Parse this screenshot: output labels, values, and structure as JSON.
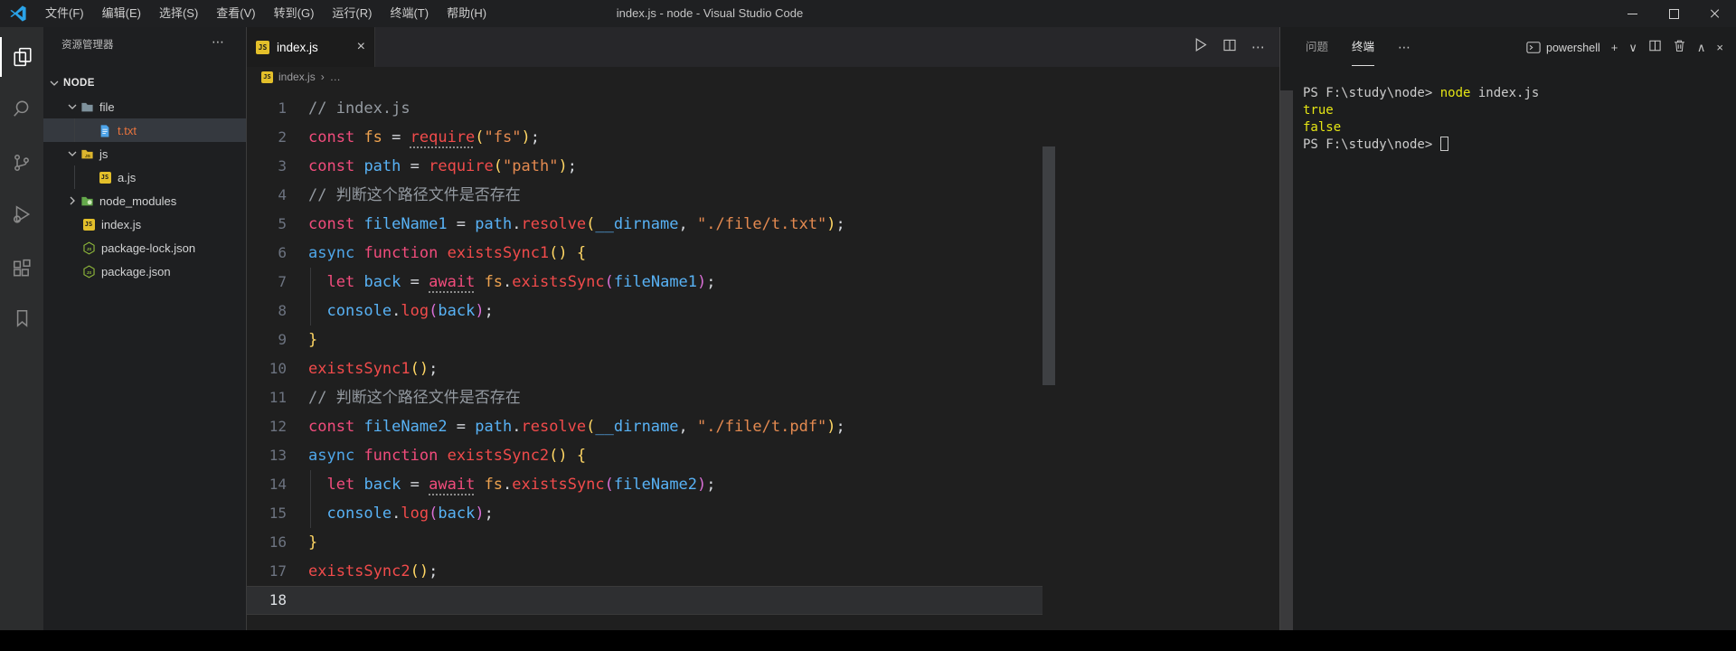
{
  "window": {
    "title": "index.js - node - Visual Studio Code",
    "menus": [
      "文件(F)",
      "编辑(E)",
      "选择(S)",
      "查看(V)",
      "转到(G)",
      "运行(R)",
      "终端(T)",
      "帮助(H)"
    ]
  },
  "icons": {
    "more": "⋯",
    "plus": "+",
    "chevron_down": "∨",
    "chevron_up": "∧",
    "close": "×",
    "breadcrumb_sep": "›",
    "breadcrumb_more": "…",
    "js_badge": "JS"
  },
  "colors": {
    "js_yellow": "#e3bf2a",
    "node_green": "#8fb83a",
    "terminal_yellow": "#e5e514",
    "modified_file_orange": "#e8743e",
    "keyword_pink": "#f14c7c",
    "function_red": "#f14b4b",
    "string_orange": "#e48a50",
    "variable_blue": "#58b2f5",
    "bracket_gold": "#ffd664",
    "bracket_orchid": "#d96fd6"
  },
  "sidebar": {
    "title": "资源管理器",
    "section": "NODE",
    "items": [
      {
        "label": "file",
        "icon": "folder",
        "chevron": "down",
        "level": 1
      },
      {
        "label": "t.txt",
        "icon": "txt",
        "level": 2,
        "selected": true
      },
      {
        "label": "js",
        "icon": "folder-js",
        "chevron": "down",
        "level": 1
      },
      {
        "label": "a.js",
        "icon": "js",
        "level": 2
      },
      {
        "label": "node_modules",
        "icon": "folder-node",
        "chevron": "right",
        "level": 1
      },
      {
        "label": "index.js",
        "icon": "js",
        "level": 1
      },
      {
        "label": "package-lock.json",
        "icon": "node",
        "level": 1
      },
      {
        "label": "package.json",
        "icon": "node",
        "level": 1
      }
    ]
  },
  "editor": {
    "tab": {
      "label": "index.js"
    },
    "breadcrumb": {
      "file": "index.js"
    },
    "lines": [
      {
        "n": 1,
        "tokens": [
          {
            "t": "// index.js",
            "c": "cmt"
          }
        ]
      },
      {
        "n": 2,
        "tokens": [
          {
            "t": "const",
            "c": "kw"
          },
          {
            "t": " ",
            "c": "op"
          },
          {
            "t": "fs",
            "c": "fsv"
          },
          {
            "t": " = ",
            "c": "op"
          },
          {
            "t": "require",
            "c": "fn",
            "hint": true
          },
          {
            "t": "(",
            "c": "p1"
          },
          {
            "t": "\"fs\"",
            "c": "str"
          },
          {
            "t": ")",
            "c": "p1"
          },
          {
            "t": ";",
            "c": "op"
          }
        ]
      },
      {
        "n": 3,
        "tokens": [
          {
            "t": "const",
            "c": "kw"
          },
          {
            "t": " ",
            "c": "op"
          },
          {
            "t": "path",
            "c": "var"
          },
          {
            "t": " = ",
            "c": "op"
          },
          {
            "t": "require",
            "c": "fn"
          },
          {
            "t": "(",
            "c": "p1"
          },
          {
            "t": "\"path\"",
            "c": "str"
          },
          {
            "t": ")",
            "c": "p1"
          },
          {
            "t": ";",
            "c": "op"
          }
        ]
      },
      {
        "n": 4,
        "tokens": [
          {
            "t": "// 判断这个路径文件是否存在",
            "c": "cmt"
          }
        ]
      },
      {
        "n": 5,
        "tokens": [
          {
            "t": "const",
            "c": "kw"
          },
          {
            "t": " ",
            "c": "op"
          },
          {
            "t": "fileName1",
            "c": "var"
          },
          {
            "t": " = ",
            "c": "op"
          },
          {
            "t": "path",
            "c": "var"
          },
          {
            "t": ".",
            "c": "op"
          },
          {
            "t": "resolve",
            "c": "fn"
          },
          {
            "t": "(",
            "c": "p1"
          },
          {
            "t": "__dirname",
            "c": "var"
          },
          {
            "t": ", ",
            "c": "op"
          },
          {
            "t": "\"./file/t.txt\"",
            "c": "str"
          },
          {
            "t": ")",
            "c": "p1"
          },
          {
            "t": ";",
            "c": "op"
          }
        ]
      },
      {
        "n": 6,
        "tokens": [
          {
            "t": "async",
            "c": "async"
          },
          {
            "t": " ",
            "c": "op"
          },
          {
            "t": "function",
            "c": "kw"
          },
          {
            "t": " ",
            "c": "op"
          },
          {
            "t": "existsSync1",
            "c": "fn"
          },
          {
            "t": "()",
            "c": "p1"
          },
          {
            "t": " ",
            "c": "op"
          },
          {
            "t": "{",
            "c": "p1"
          }
        ]
      },
      {
        "n": 7,
        "guide": true,
        "tokens": [
          {
            "t": "  ",
            "c": "op"
          },
          {
            "t": "let",
            "c": "kw"
          },
          {
            "t": " ",
            "c": "op"
          },
          {
            "t": "back",
            "c": "var"
          },
          {
            "t": " = ",
            "c": "op"
          },
          {
            "t": "await",
            "c": "kw",
            "hint": true
          },
          {
            "t": " ",
            "c": "op"
          },
          {
            "t": "fs",
            "c": "fsv"
          },
          {
            "t": ".",
            "c": "op"
          },
          {
            "t": "existsSync",
            "c": "fn"
          },
          {
            "t": "(",
            "c": "p2"
          },
          {
            "t": "fileName1",
            "c": "var"
          },
          {
            "t": ")",
            "c": "p2"
          },
          {
            "t": ";",
            "c": "op"
          }
        ]
      },
      {
        "n": 8,
        "guide": true,
        "tokens": [
          {
            "t": "  ",
            "c": "op"
          },
          {
            "t": "console",
            "c": "var"
          },
          {
            "t": ".",
            "c": "op"
          },
          {
            "t": "log",
            "c": "fn"
          },
          {
            "t": "(",
            "c": "p2"
          },
          {
            "t": "back",
            "c": "var"
          },
          {
            "t": ")",
            "c": "p2"
          },
          {
            "t": ";",
            "c": "op"
          }
        ]
      },
      {
        "n": 9,
        "tokens": [
          {
            "t": "}",
            "c": "p1"
          }
        ]
      },
      {
        "n": 10,
        "tokens": [
          {
            "t": "existsSync1",
            "c": "fn"
          },
          {
            "t": "()",
            "c": "p1"
          },
          {
            "t": ";",
            "c": "op"
          }
        ]
      },
      {
        "n": 11,
        "tokens": [
          {
            "t": "// 判断这个路径文件是否存在",
            "c": "cmt"
          }
        ]
      },
      {
        "n": 12,
        "tokens": [
          {
            "t": "const",
            "c": "kw"
          },
          {
            "t": " ",
            "c": "op"
          },
          {
            "t": "fileName2",
            "c": "var"
          },
          {
            "t": " = ",
            "c": "op"
          },
          {
            "t": "path",
            "c": "var"
          },
          {
            "t": ".",
            "c": "op"
          },
          {
            "t": "resolve",
            "c": "fn"
          },
          {
            "t": "(",
            "c": "p1"
          },
          {
            "t": "__dirname",
            "c": "var"
          },
          {
            "t": ", ",
            "c": "op"
          },
          {
            "t": "\"./file/t.pdf\"",
            "c": "str"
          },
          {
            "t": ")",
            "c": "p1"
          },
          {
            "t": ";",
            "c": "op"
          }
        ]
      },
      {
        "n": 13,
        "tokens": [
          {
            "t": "async",
            "c": "async"
          },
          {
            "t": " ",
            "c": "op"
          },
          {
            "t": "function",
            "c": "kw"
          },
          {
            "t": " ",
            "c": "op"
          },
          {
            "t": "existsSync2",
            "c": "fn"
          },
          {
            "t": "()",
            "c": "p1"
          },
          {
            "t": " ",
            "c": "op"
          },
          {
            "t": "{",
            "c": "p1"
          }
        ]
      },
      {
        "n": 14,
        "guide": true,
        "tokens": [
          {
            "t": "  ",
            "c": "op"
          },
          {
            "t": "let",
            "c": "kw"
          },
          {
            "t": " ",
            "c": "op"
          },
          {
            "t": "back",
            "c": "var"
          },
          {
            "t": " = ",
            "c": "op"
          },
          {
            "t": "await",
            "c": "kw",
            "hint": true
          },
          {
            "t": " ",
            "c": "op"
          },
          {
            "t": "fs",
            "c": "fsv"
          },
          {
            "t": ".",
            "c": "op"
          },
          {
            "t": "existsSync",
            "c": "fn"
          },
          {
            "t": "(",
            "c": "p2"
          },
          {
            "t": "fileName2",
            "c": "var"
          },
          {
            "t": ")",
            "c": "p2"
          },
          {
            "t": ";",
            "c": "op"
          }
        ]
      },
      {
        "n": 15,
        "guide": true,
        "tokens": [
          {
            "t": "  ",
            "c": "op"
          },
          {
            "t": "console",
            "c": "var"
          },
          {
            "t": ".",
            "c": "op"
          },
          {
            "t": "log",
            "c": "fn"
          },
          {
            "t": "(",
            "c": "p2"
          },
          {
            "t": "back",
            "c": "var"
          },
          {
            "t": ")",
            "c": "p2"
          },
          {
            "t": ";",
            "c": "op"
          }
        ]
      },
      {
        "n": 16,
        "tokens": [
          {
            "t": "}",
            "c": "p1"
          }
        ]
      },
      {
        "n": 17,
        "tokens": [
          {
            "t": "existsSync2",
            "c": "fn"
          },
          {
            "t": "()",
            "c": "p1"
          },
          {
            "t": ";",
            "c": "op"
          }
        ]
      },
      {
        "n": 18,
        "current": true,
        "tokens": []
      }
    ]
  },
  "panel": {
    "tabs": [
      "问题",
      "终端"
    ],
    "active_tab": "终端",
    "shell": "powershell",
    "terminal": [
      {
        "segs": [
          {
            "t": "PS F:\\study\\node> ",
            "c": "fg"
          },
          {
            "t": "node",
            "c": "y"
          },
          {
            "t": " index.js",
            "c": "fg"
          }
        ]
      },
      {
        "segs": [
          {
            "t": "true",
            "c": "y"
          }
        ]
      },
      {
        "segs": [
          {
            "t": "false",
            "c": "y"
          }
        ]
      },
      {
        "segs": [
          {
            "t": "PS F:\\study\\node> ",
            "c": "fg"
          },
          {
            "cursor": true
          }
        ]
      }
    ]
  }
}
